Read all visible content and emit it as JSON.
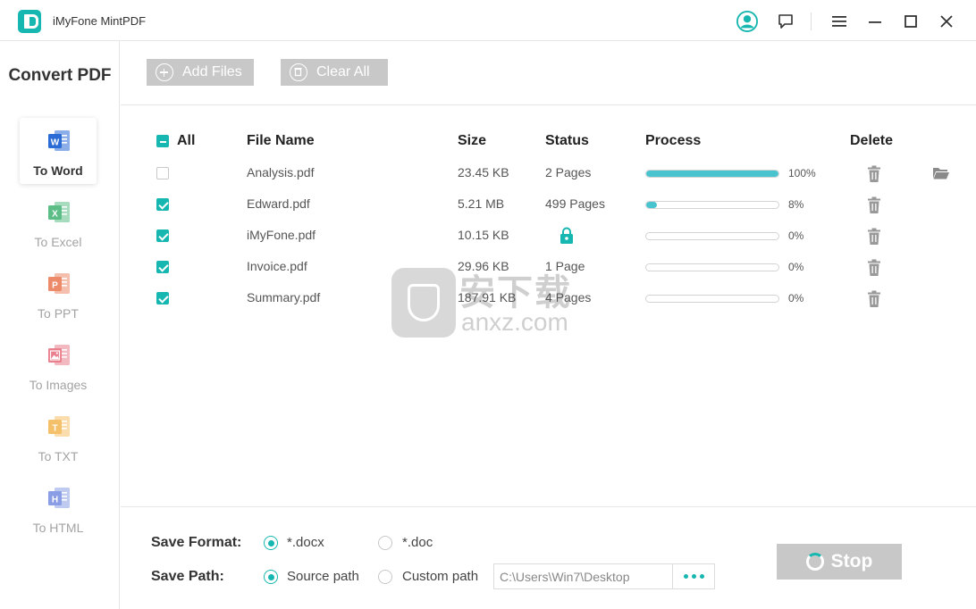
{
  "app": {
    "title": "iMyFone MintPDF"
  },
  "titlebar_icons": [
    "account-icon",
    "feedback-icon",
    "menu-icon",
    "minimize-icon",
    "maximize-icon",
    "close-icon"
  ],
  "sidebar": {
    "title": "Convert PDF",
    "items": [
      {
        "label": "To Word",
        "letter": "W",
        "color": "#2b6bd6",
        "active": true
      },
      {
        "label": "To Excel",
        "letter": "X",
        "color": "#5cbd86",
        "active": false
      },
      {
        "label": "To PPT",
        "letter": "P",
        "color": "#ec8a6a",
        "active": false
      },
      {
        "label": "To Images",
        "letter": "",
        "color": "#ea7f8d",
        "active": false
      },
      {
        "label": "To TXT",
        "letter": "T",
        "color": "#f5c06a",
        "active": false
      },
      {
        "label": "To HTML",
        "letter": "H",
        "color": "#8a9ee6",
        "active": false
      }
    ]
  },
  "toolbar": {
    "add_files_label": "Add Files",
    "clear_all_label": "Clear All"
  },
  "table": {
    "headers": {
      "all": "All",
      "file_name": "File Name",
      "size": "Size",
      "status": "Status",
      "process": "Process",
      "delete": "Delete"
    },
    "rows": [
      {
        "checked": false,
        "name": "Analysis.pdf",
        "size": "23.45 KB",
        "status": "2 Pages",
        "progress": 100,
        "progress_label": "100%",
        "locked": false,
        "done": true
      },
      {
        "checked": true,
        "name": "Edward.pdf",
        "size": "5.21 MB",
        "status": "499 Pages",
        "progress": 8,
        "progress_label": "8%",
        "locked": false,
        "done": false
      },
      {
        "checked": true,
        "name": "iMyFone.pdf",
        "size": "10.15 KB",
        "status": "",
        "progress": 0,
        "progress_label": "0%",
        "locked": true,
        "done": false
      },
      {
        "checked": true,
        "name": "Invoice.pdf",
        "size": "29.96 KB",
        "status": "1 Page",
        "progress": 0,
        "progress_label": "0%",
        "locked": false,
        "done": false
      },
      {
        "checked": true,
        "name": "Summary.pdf",
        "size": "187.91 KB",
        "status": "4 Pages",
        "progress": 0,
        "progress_label": "0%",
        "locked": false,
        "done": false
      }
    ]
  },
  "watermark": {
    "cn": "安下载",
    "en": "anxz.com"
  },
  "bottom": {
    "save_format_label": "Save Format:",
    "format_options": [
      {
        "label": "*.docx",
        "selected": true
      },
      {
        "label": "*.doc",
        "selected": false
      }
    ],
    "save_path_label": "Save Path:",
    "path_options": [
      {
        "label": "Source path",
        "selected": true
      },
      {
        "label": "Custom path",
        "selected": false
      }
    ],
    "path_value": "C:\\Users\\Win7\\Desktop",
    "stop_label": "Stop"
  },
  "colors": {
    "accent": "#16b7b0",
    "progress": "#49c4cf",
    "disabled": "#c8c8c8"
  }
}
